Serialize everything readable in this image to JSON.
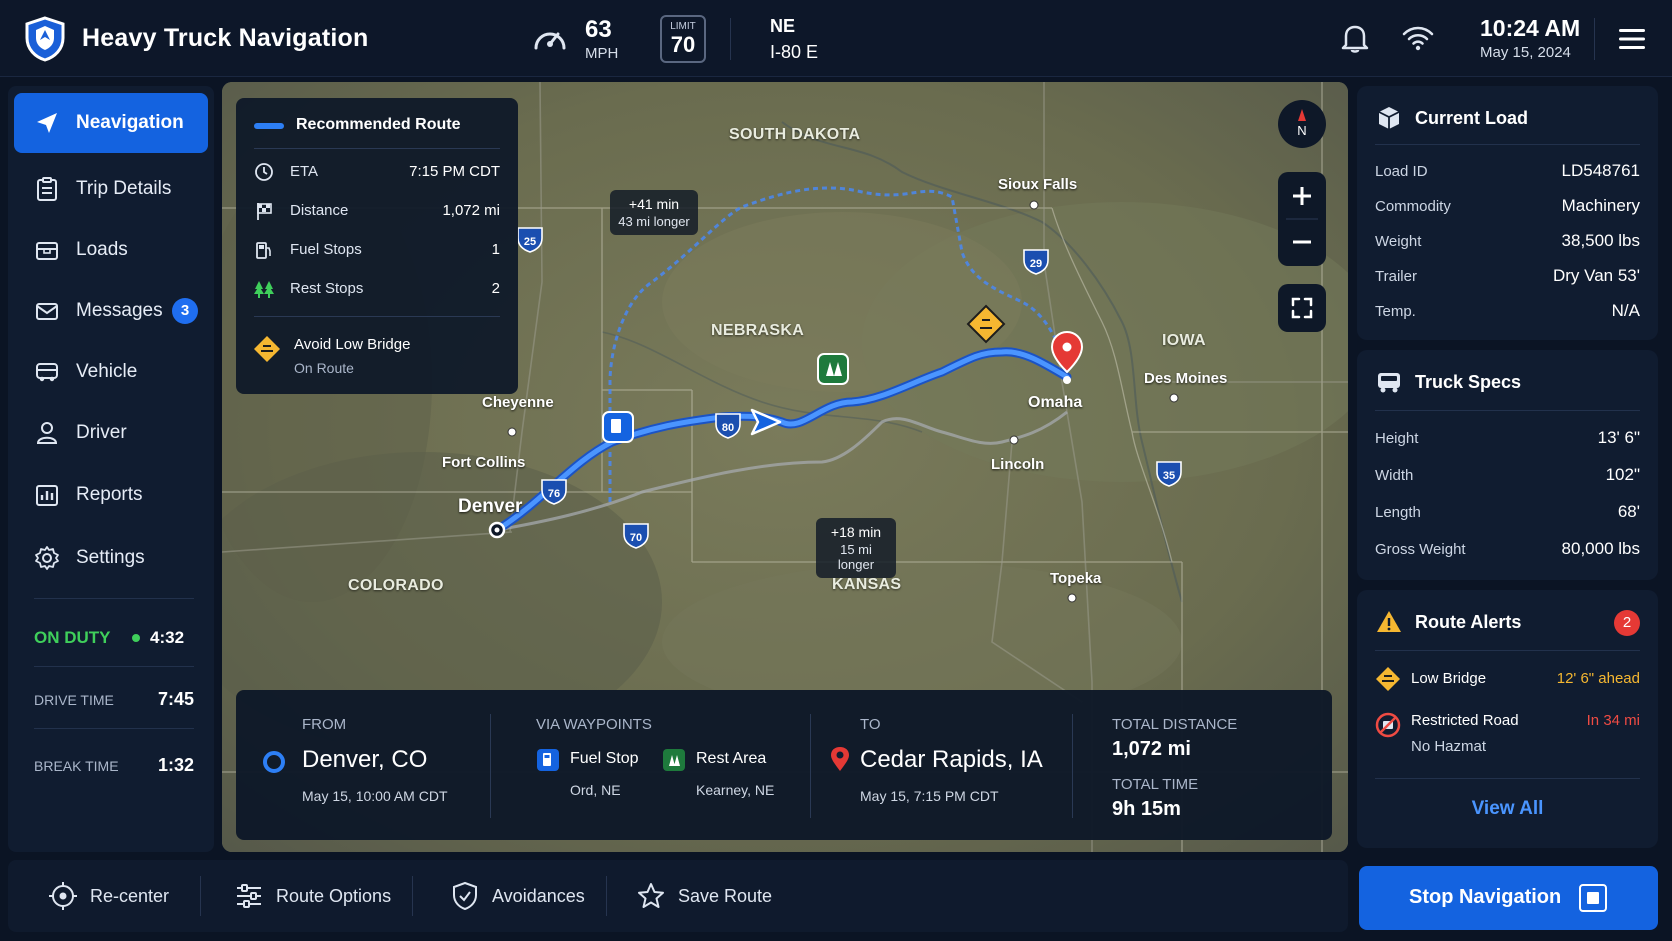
{
  "header": {
    "app_title": "Heavy Truck Navigation",
    "speed": "63",
    "speed_unit": "MPH",
    "limit_label": "LIMIT",
    "limit_value": "70",
    "direction": "NE",
    "road": "I-80 E",
    "time": "10:24 AM",
    "date": "May 15, 2024"
  },
  "sidebar": {
    "items": [
      {
        "label": "Neavigation",
        "icon": "navigation-arrow-icon"
      },
      {
        "label": "Trip Details",
        "icon": "clipboard-icon"
      },
      {
        "label": "Loads",
        "icon": "box-icon"
      },
      {
        "label": "Messages",
        "icon": "envelope-icon",
        "badge": "3"
      },
      {
        "label": "Vehicle",
        "icon": "truck-icon"
      },
      {
        "label": "Driver",
        "icon": "person-icon"
      },
      {
        "label": "Reports",
        "icon": "chart-icon"
      },
      {
        "label": "Settings",
        "icon": "gear-icon"
      }
    ],
    "duty_status": "ON DUTY",
    "duty_time": "4:32",
    "drive_label": "DRIVE TIME",
    "drive_value": "7:45",
    "break_label": "BREAK TIME",
    "break_value": "1:32"
  },
  "route_card": {
    "title": "Recommended Route",
    "rows": [
      {
        "key": "ETA",
        "value": "7:15 PM CDT",
        "icon": "clock-icon"
      },
      {
        "key": "Distance",
        "value": "1,072 mi",
        "icon": "flag-icon"
      },
      {
        "key": "Fuel Stops",
        "value": "1",
        "icon": "fuel-icon"
      },
      {
        "key": "Rest Stops",
        "value": "2",
        "icon": "trees-icon"
      }
    ],
    "warning_title": "Avoid Low Bridge",
    "warning_sub": "On Route"
  },
  "map": {
    "states": [
      "SOUTH DAKOTA",
      "NEBRASKA",
      "IOWA",
      "COLORADO",
      "KANSAS"
    ],
    "cities": [
      "Sioux Falls",
      "Cheyenne",
      "Fort Collins",
      "Denver",
      "Omaha",
      "Lincoln",
      "Des Moines",
      "Topeka"
    ],
    "highways": [
      "25",
      "29",
      "76",
      "70",
      "35",
      "80"
    ],
    "compass": "N",
    "alt_north": {
      "delay": "+41 min",
      "extra": "43 mi longer"
    },
    "alt_south": {
      "delay": "+18 min",
      "extra": "15 mi longer"
    },
    "route_color": "#2d7ff5"
  },
  "trip": {
    "from_label": "FROM",
    "from_city": "Denver, CO",
    "from_time": "May 15, 10:00 AM CDT",
    "via_label": "VIA WAYPOINTS",
    "wp1_name": "Fuel Stop",
    "wp1_loc": "Ord, NE",
    "wp2_name": "Rest Area",
    "wp2_loc": "Kearney, NE",
    "to_label": "TO",
    "to_city": "Cedar Rapids, IA",
    "to_time": "May 15, 7:15 PM CDT",
    "dist_label": "TOTAL DISTANCE",
    "dist_value": "1,072 mi",
    "time_label": "TOTAL TIME",
    "time_value": "9h 15m"
  },
  "current_load": {
    "title": "Current Load",
    "rows": [
      {
        "key": "Load ID",
        "value": "LD548761"
      },
      {
        "key": "Commodity",
        "value": "Machinery"
      },
      {
        "key": "Weight",
        "value": "38,500 lbs"
      },
      {
        "key": "Trailer",
        "value": "Dry Van 53'"
      },
      {
        "key": "Temp.",
        "value": "N/A"
      }
    ]
  },
  "truck_specs": {
    "title": "Truck Specs",
    "rows": [
      {
        "key": "Height",
        "value": "13' 6\""
      },
      {
        "key": "Width",
        "value": "102\""
      },
      {
        "key": "Length",
        "value": "68'"
      },
      {
        "key": "Gross Weight",
        "value": "80,000 lbs"
      }
    ]
  },
  "route_alerts": {
    "title": "Route Alerts",
    "count": "2",
    "alerts": [
      {
        "title": "Low Bridge",
        "sub": "",
        "status": "12' 6\" ahead",
        "status_color": "#f5b731"
      },
      {
        "title": "Restricted Road",
        "sub": "No Hazmat",
        "status": "In 34 mi",
        "status_color": "#ef4b43"
      }
    ],
    "view_all": "View All"
  },
  "toolbar": {
    "recenter": "Re-center",
    "route_options": "Route Options",
    "avoidances": "Avoidances",
    "save_route": "Save Route",
    "stop": "Stop Navigation"
  }
}
